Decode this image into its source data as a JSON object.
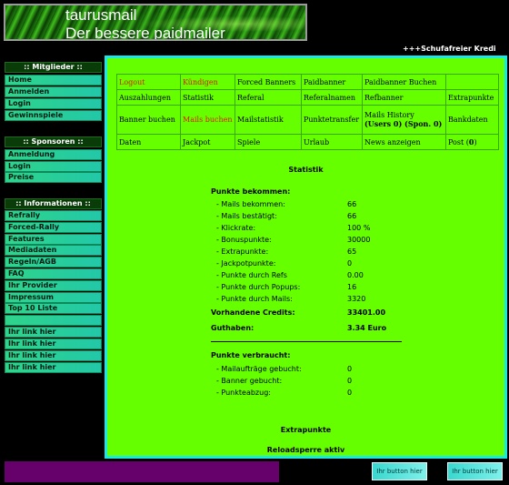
{
  "header": {
    "line1": "taurusmail",
    "line2": "Der bessere paidmailer"
  },
  "marquee": "+++Schufafreier Kredi",
  "sidebar": {
    "mitglieder": {
      "title": ":: Mitglieder ::",
      "items": [
        "Home",
        "Anmelden",
        "Login",
        "Gewinnspiele"
      ]
    },
    "sponsoren": {
      "title": ":: Sponsoren ::",
      "items": [
        "Anmeldung",
        "Login",
        "Preise"
      ]
    },
    "informationen": {
      "title": ":: Informationen ::",
      "items": [
        "Refrally",
        "Forced-Rally",
        "Features",
        "Mediadaten",
        "Regeln/AGB",
        "FAQ",
        "Ihr Provider",
        "Impressum",
        "Top 10 Liste"
      ]
    },
    "links": [
      "Ihr link hier",
      "Ihr link hier",
      "Ihr link hier",
      "Ihr link hier"
    ]
  },
  "nav": {
    "row1": [
      "Logout",
      "Kündigen",
      "Forced Banners",
      "Paidbanner",
      "Paidbanner Buchen",
      ""
    ],
    "row2": [
      "Auszahlungen",
      "Statistik",
      "Referal",
      "Referalnamen",
      "Refbanner",
      "Extrapunkte"
    ],
    "row3": [
      "Banner buchen",
      "Mails buchen",
      "Mailstatistik",
      "Punktetransfer",
      "Mails History",
      "Bankdaten"
    ],
    "row3_history_sub": {
      "users_label": "Users",
      "users_count": "0",
      "spon_label": "Spon.",
      "spon_count": "0"
    },
    "row4": [
      "Daten",
      "Jackpot",
      "Spiele",
      "Urlaub",
      "News anzeigen",
      "Post"
    ],
    "post_count": "0"
  },
  "statistik": {
    "title": "Statistik",
    "bekommen_header": "Punkte bekommen:",
    "bekommen": [
      {
        "label": "- Mails bekommen:",
        "value": "66"
      },
      {
        "label": "- Mails bestätigt:",
        "value": "66"
      },
      {
        "label": "- Klickrate:",
        "value": "100 %"
      },
      {
        "label": "- Bonuspunkte:",
        "value": "30000"
      },
      {
        "label": "- Extrapunkte:",
        "value": "65"
      },
      {
        "label": "- Jackpotpunkte:",
        "value": "0"
      },
      {
        "label": "- Punkte durch Refs",
        "value": "0.00"
      },
      {
        "label": "- Punkte durch Popups:",
        "value": "16"
      },
      {
        "label": "- Punkte durch Mails:",
        "value": "3320"
      }
    ],
    "credits_label": "Vorhandene Credits:",
    "credits_value": "33401.00",
    "guthaben_label": "Guthaben:",
    "guthaben_value": "3.34 Euro",
    "verbraucht_header": "Punkte verbraucht:",
    "verbraucht": [
      {
        "label": "- Mailaufträge gebucht:",
        "value": "0"
      },
      {
        "label": "- Banner gebucht:",
        "value": "0"
      },
      {
        "label": "- Punkteabzug:",
        "value": "0"
      }
    ]
  },
  "extrapunkte_title": "Extrapunkte",
  "reload_text": "Reloadsperre aktiv",
  "buttons": [
    "Ihr button hier",
    "Ihr button hier"
  ]
}
